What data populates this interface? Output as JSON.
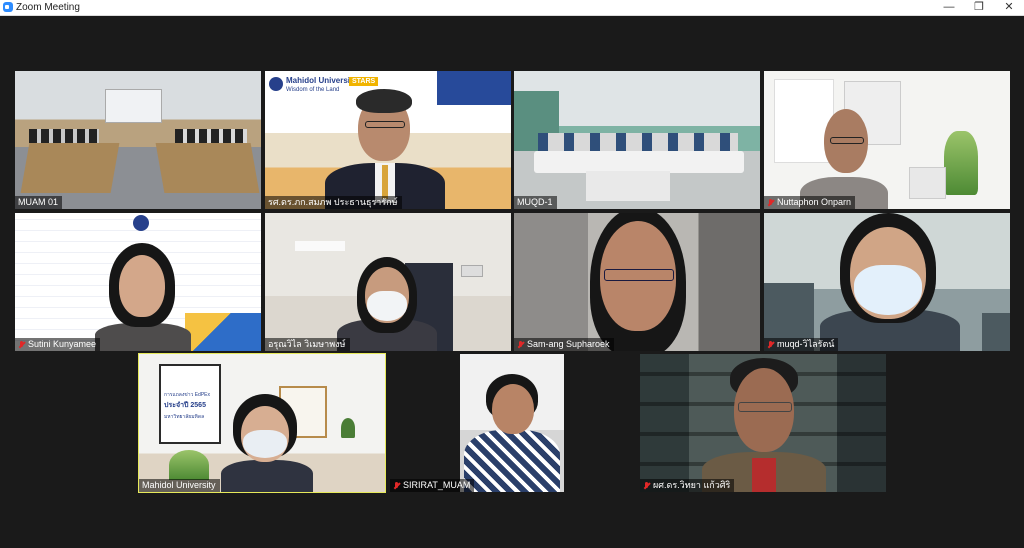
{
  "window": {
    "title": "Zoom Meeting",
    "controls": [
      "—",
      "❐",
      "✕"
    ]
  },
  "participants": [
    {
      "name": "MUAM 01",
      "muted": false
    },
    {
      "name": "รศ.ดร.ภก.สมภพ ประธานธุรารักษ์",
      "muted": false
    },
    {
      "name": "MUQD-1",
      "muted": false
    },
    {
      "name": "Nuttaphon Onparn",
      "muted": true
    },
    {
      "name": "Sutini Kunyamee",
      "muted": true
    },
    {
      "name": "อรุณวิไล วิเมษาพงษ์",
      "muted": false
    },
    {
      "name": "Sam-ang Supharoek",
      "muted": true
    },
    {
      "name": "muqd-วิไลรัตน์",
      "muted": true
    },
    {
      "name": "Mahidol University",
      "muted": false,
      "active_speaker": true
    },
    {
      "name": "SIRIRAT_MUAM",
      "muted": true
    },
    {
      "name": "ผศ.ดร.วิทยา แก้วศิริ",
      "muted": true
    }
  ],
  "backgrounds": {
    "mahidol_banner": {
      "logo_text": "Mahidol University",
      "motto": "Wisdom of the Land",
      "badge": "STARS"
    },
    "edpex_poster": {
      "lines": [
        "การแถลงข่าว EdPEx",
        "ประจำปี 2565",
        "มหาวิทยาลัยมหิดล"
      ]
    }
  }
}
